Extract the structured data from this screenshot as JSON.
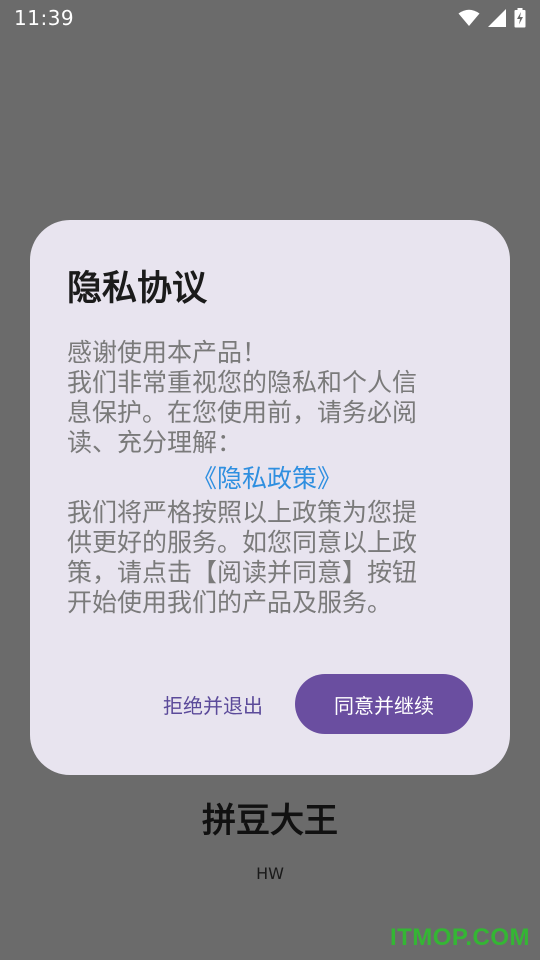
{
  "status_bar": {
    "time": "11:39",
    "icons": [
      "wifi-icon",
      "cellular-signal-icon",
      "battery-charging-icon"
    ]
  },
  "dialog": {
    "title": "隐私协议",
    "body_lines_1": [
      "感谢使用本产品！",
      "我们非常重视您的隐私和个人信",
      "息保护。在您使用前，请务必阅",
      "读、充分理解："
    ],
    "policy_link": "《隐私政策》",
    "body_lines_2": [
      "我们将严格按照以上政策为您提",
      "供更好的服务。如您同意以上政",
      "策，请点击【阅读并同意】按钮",
      "开始使用我们的产品及服务。"
    ],
    "decline_label": "拒绝并退出",
    "accept_label": "同意并继续"
  },
  "background": {
    "app_name": "拼豆大王",
    "app_sub": "HW"
  },
  "watermark": "ITMOP.COM",
  "colors": {
    "scrim": "#6b6b6b",
    "dialog_bg": "#e8e4ef",
    "accent": "#6a4ea0",
    "link": "#2f8fe0",
    "body_text": "#7a7a7a"
  }
}
